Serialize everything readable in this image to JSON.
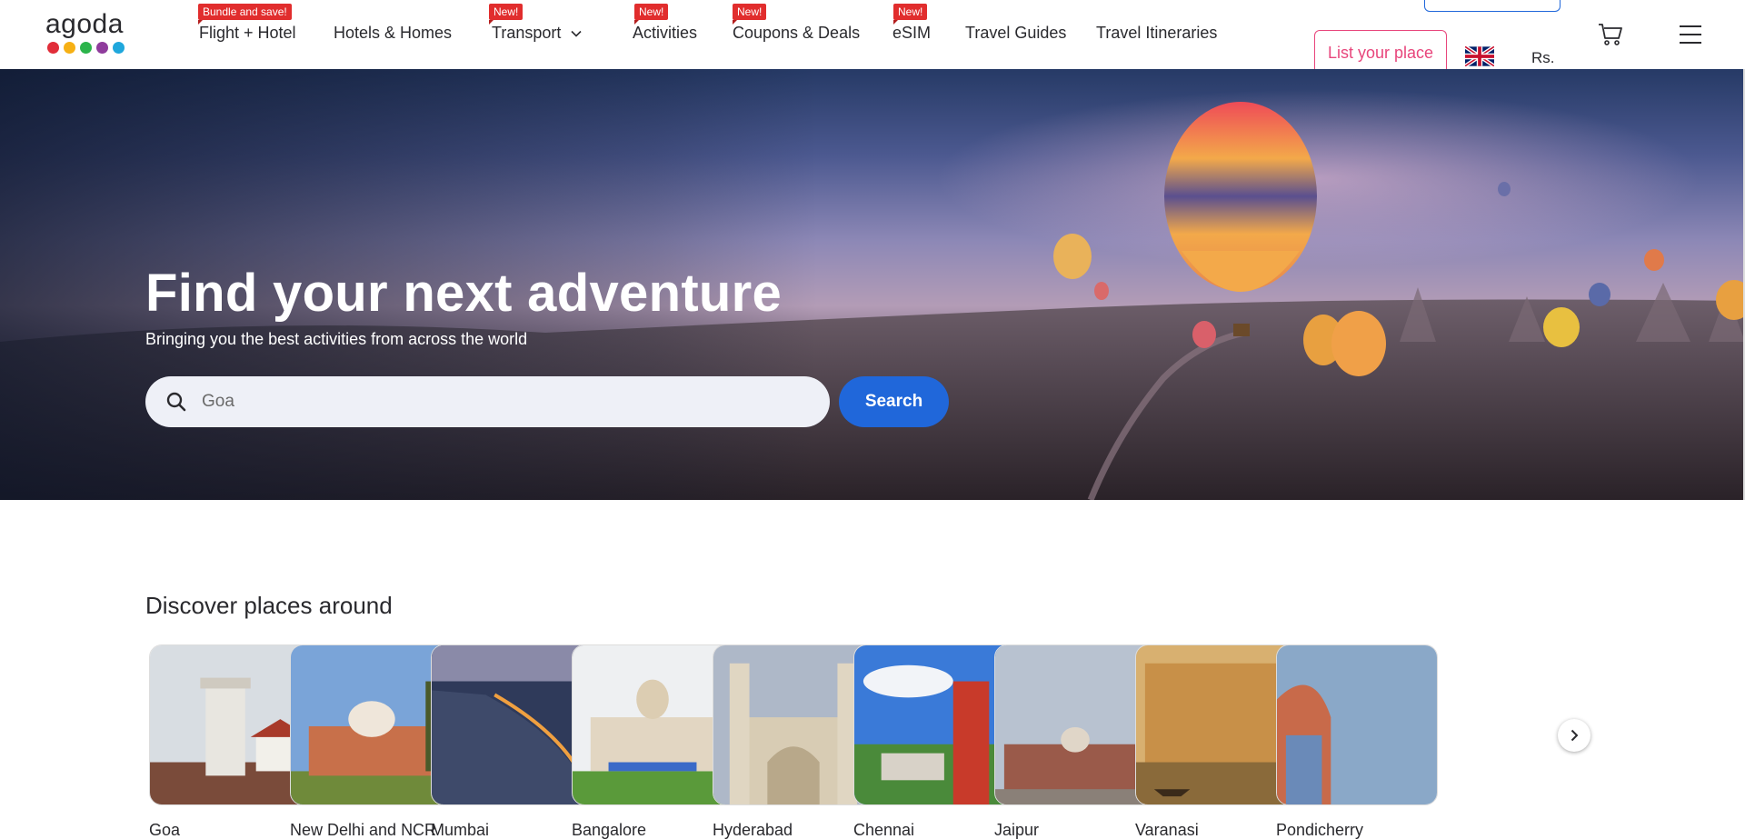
{
  "brand": {
    "logo_text": "agoda",
    "dot_colors": [
      "#e12d39",
      "#f6b014",
      "#2bb44b",
      "#8f3c9c",
      "#1fa7dc"
    ]
  },
  "nav": {
    "items": [
      {
        "label": "Flight + Hotel",
        "badge": "Bundle and save!"
      },
      {
        "label": "Hotels & Homes",
        "badge": ""
      },
      {
        "label": "Transport",
        "badge": "New!"
      },
      {
        "label": "Activities",
        "badge": "New!"
      },
      {
        "label": "Coupons & Deals",
        "badge": "New!"
      },
      {
        "label": "eSIM",
        "badge": "New!"
      },
      {
        "label": "Travel Guides",
        "badge": ""
      },
      {
        "label": "Travel Itineraries",
        "badge": ""
      }
    ]
  },
  "header_right": {
    "list_place_label": "List your place",
    "currency": "Rs.",
    "flag_icon": "uk-flag-icon",
    "cart_icon": "cart-icon",
    "menu_icon": "hamburger-menu-icon"
  },
  "hero": {
    "title": "Find your next adventure",
    "subtitle": "Bringing you the best activities from across the world",
    "search_placeholder": "Goa",
    "search_button": "Search"
  },
  "discover": {
    "title": "Discover places around",
    "places": [
      {
        "name": "Goa"
      },
      {
        "name": "New Delhi and NCR"
      },
      {
        "name": "Mumbai"
      },
      {
        "name": "Bangalore"
      },
      {
        "name": "Hyderabad"
      },
      {
        "name": "Chennai"
      },
      {
        "name": "Jaipur"
      },
      {
        "name": "Varanasi"
      },
      {
        "name": "Pondicherry"
      }
    ],
    "next_icon": "chevron-right-icon"
  },
  "colors": {
    "accent_blue": "#2067da",
    "badge_red": "#e12d2d",
    "list_place_pink": "#e8467c"
  }
}
